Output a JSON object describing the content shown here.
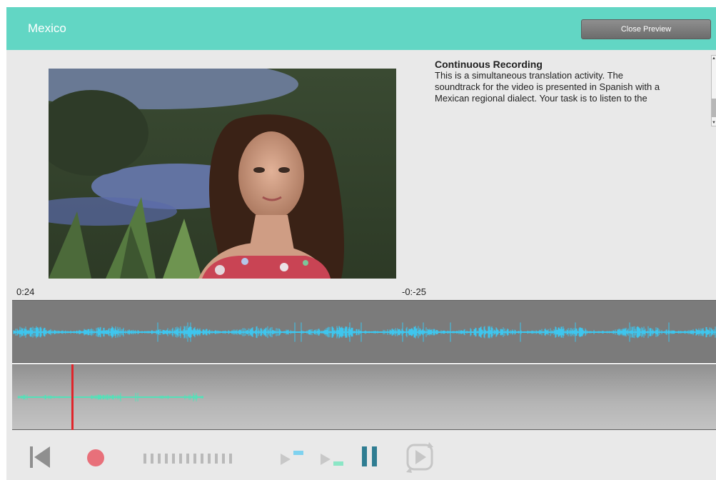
{
  "header": {
    "title": "Mexico",
    "close_button_label": "Close Preview"
  },
  "description": {
    "heading": "Continuous Recording",
    "lines": [
      "This is a simultaneous translation activity.   The",
      "soundtrack for the video is presented in Spanish with a",
      "Mexican regional dialect.    Your task is to listen to the"
    ]
  },
  "timeline": {
    "elapsed": "0:24",
    "remaining": "-0:-25",
    "playhead_fraction": 0.084
  },
  "controls": {
    "skip_back": "skip-to-start-icon",
    "record": "record-icon",
    "level_meter": "level-meter-icon",
    "play_source": "play-source-icon",
    "play_recording": "play-recording-icon",
    "pause": "pause-icon",
    "replay": "replay-icon"
  },
  "colors": {
    "header": "#62d6c4",
    "source_waveform": "#3ec6ee",
    "recording_waveform": "#55e0b8",
    "playhead": "#e0252b",
    "record": "#e8707a",
    "pause": "#2f7d92"
  }
}
